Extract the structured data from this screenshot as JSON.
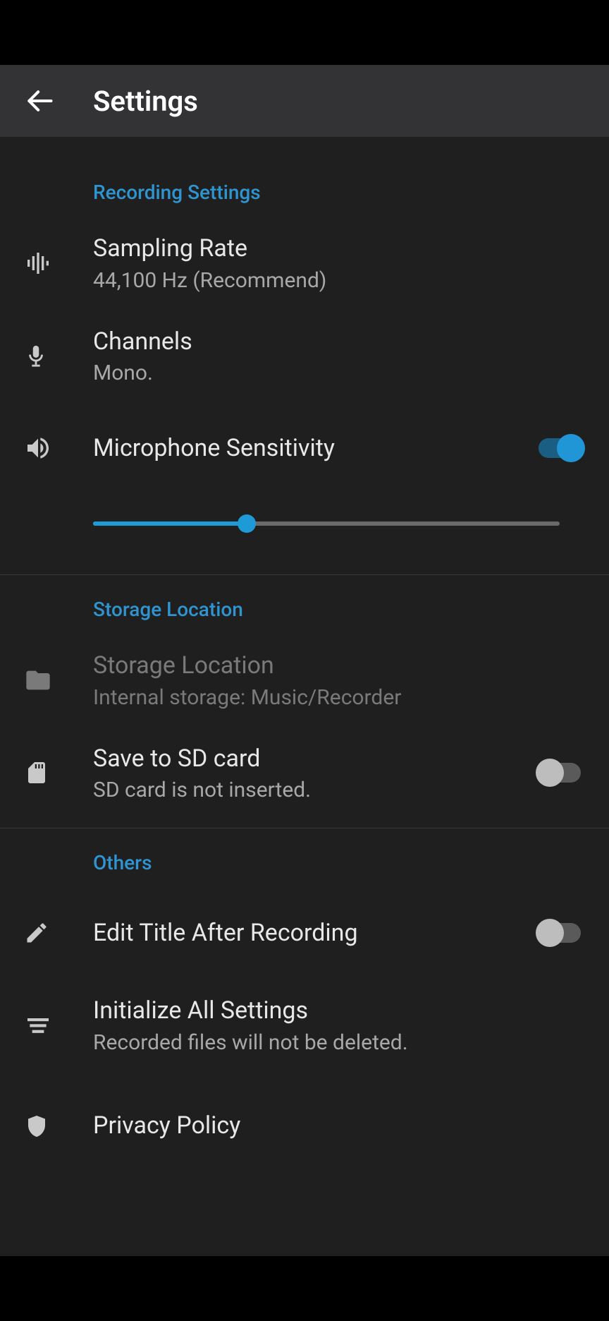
{
  "header": {
    "title": "Settings"
  },
  "sections": {
    "recording": {
      "label": "Recording Settings",
      "sampling_rate": {
        "title": "Sampling Rate",
        "value": "44,100 Hz (Recommend)"
      },
      "channels": {
        "title": "Channels",
        "value": "Mono."
      },
      "mic_sens": {
        "title": "Microphone Sensitivity",
        "enabled": true,
        "slider_pct": 33
      }
    },
    "storage": {
      "label": "Storage Location",
      "location": {
        "title": "Storage Location",
        "value": "Internal storage: Music/Recorder"
      },
      "sd_card": {
        "title": "Save to SD card",
        "value": "SD card is not inserted.",
        "enabled": false
      }
    },
    "others": {
      "label": "Others",
      "edit_title": {
        "title": "Edit Title After Recording",
        "enabled": false
      },
      "init_all": {
        "title": "Initialize All Settings",
        "value": "Recorded files will not be deleted."
      },
      "privacy": {
        "title": "Privacy Policy"
      }
    }
  },
  "colors": {
    "accent": "#1e9bd7",
    "section": "#2f94cf"
  }
}
